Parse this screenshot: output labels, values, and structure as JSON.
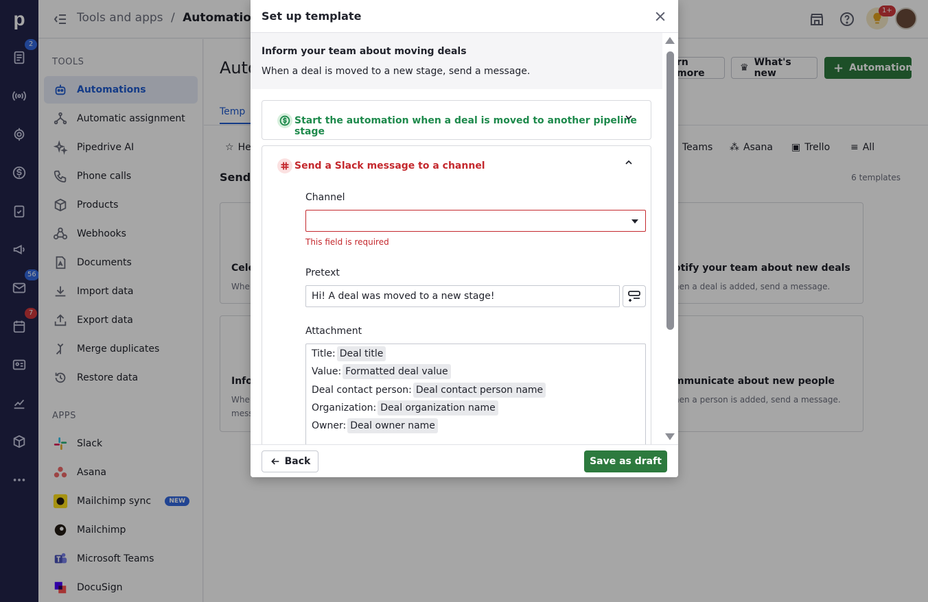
{
  "rail": {
    "logo": "p",
    "badges": {
      "deals": "2",
      "mail": "56",
      "calendar": "7"
    }
  },
  "header": {
    "breadcrumb_parent": "Tools and apps",
    "breadcrumb_sep": "/",
    "breadcrumb_current": "Automations",
    "tips_badge": "1+"
  },
  "sidebar": {
    "tools_heading": "TOOLS",
    "tools": [
      {
        "label": "Automations",
        "icon": "robot-icon"
      },
      {
        "label": "Automatic assignment",
        "icon": "assignment-icon"
      },
      {
        "label": "Pipedrive AI",
        "icon": "sparkle-icon"
      },
      {
        "label": "Phone calls",
        "icon": "phone-icon"
      },
      {
        "label": "Products",
        "icon": "box-icon"
      },
      {
        "label": "Webhooks",
        "icon": "webhook-icon"
      },
      {
        "label": "Documents",
        "icon": "document-icon"
      },
      {
        "label": "Import data",
        "icon": "import-icon"
      },
      {
        "label": "Export data",
        "icon": "export-icon"
      },
      {
        "label": "Merge duplicates",
        "icon": "merge-icon"
      },
      {
        "label": "Restore data",
        "icon": "restore-icon"
      }
    ],
    "apps_heading": "APPS",
    "apps": [
      {
        "label": "Slack",
        "icon": "slack-icon"
      },
      {
        "label": "Asana",
        "icon": "asana-icon"
      },
      {
        "label": "Mailchimp sync",
        "icon": "mailchimp-icon",
        "badge": "NEW"
      },
      {
        "label": "Mailchimp",
        "icon": "mailchimp-icon"
      },
      {
        "label": "Microsoft Teams",
        "icon": "teams-icon"
      },
      {
        "label": "DocuSign",
        "icon": "docusign-icon"
      }
    ]
  },
  "main": {
    "title": "Auto",
    "tab": "Temp",
    "learn_more": "rn more",
    "whats_new": "What's new",
    "add_automation": "Automation",
    "filter_home": "He",
    "filters": [
      "Teams",
      "Asana",
      "Trello",
      "All"
    ],
    "section_title": "Send",
    "count": "6 templates",
    "cards": [
      {
        "title": "Cele",
        "sub": "When"
      },
      {
        "title": "otify your team about new deals",
        "sub": "hen a deal is added, send a message."
      },
      {
        "title": "Infor",
        "sub": "When",
        "sub2": "mess"
      },
      {
        "title": "mmunicate about new people",
        "sub": "hen a person is added, send a message."
      }
    ]
  },
  "modal": {
    "title": "Set up template",
    "intro_title": "Inform your team about moving deals",
    "intro_sub": "When a deal is moved to a new stage, send a message.",
    "trigger_title": "Start the automation when a deal is moved to another pipeline stage",
    "action_title": "Send a Slack message to a channel",
    "channel_label": "Channel",
    "channel_value": "",
    "channel_error": "This field is required",
    "pretext_label": "Pretext",
    "pretext_value": "Hi! A deal was moved to a new stage!",
    "attachment_label": "Attachment",
    "attachment_rows": [
      {
        "label": "Title:",
        "chip": "Deal title"
      },
      {
        "label": "Value:",
        "chip": "Formatted deal value"
      },
      {
        "label": "Deal contact person:",
        "chip": "Deal contact person name"
      },
      {
        "label": "Organization:",
        "chip": "Deal organization name"
      },
      {
        "label": "Owner:",
        "chip": "Deal owner name"
      }
    ],
    "back_label": "Back",
    "save_label": "Save as draft"
  },
  "colors": {
    "rail": "#22244a",
    "accent_blue": "#1f5bd0",
    "primary_green": "#2d7a3e",
    "error_red": "#c4282d",
    "trigger_green": "#1e8a4c",
    "action_red": "#c4282d"
  }
}
